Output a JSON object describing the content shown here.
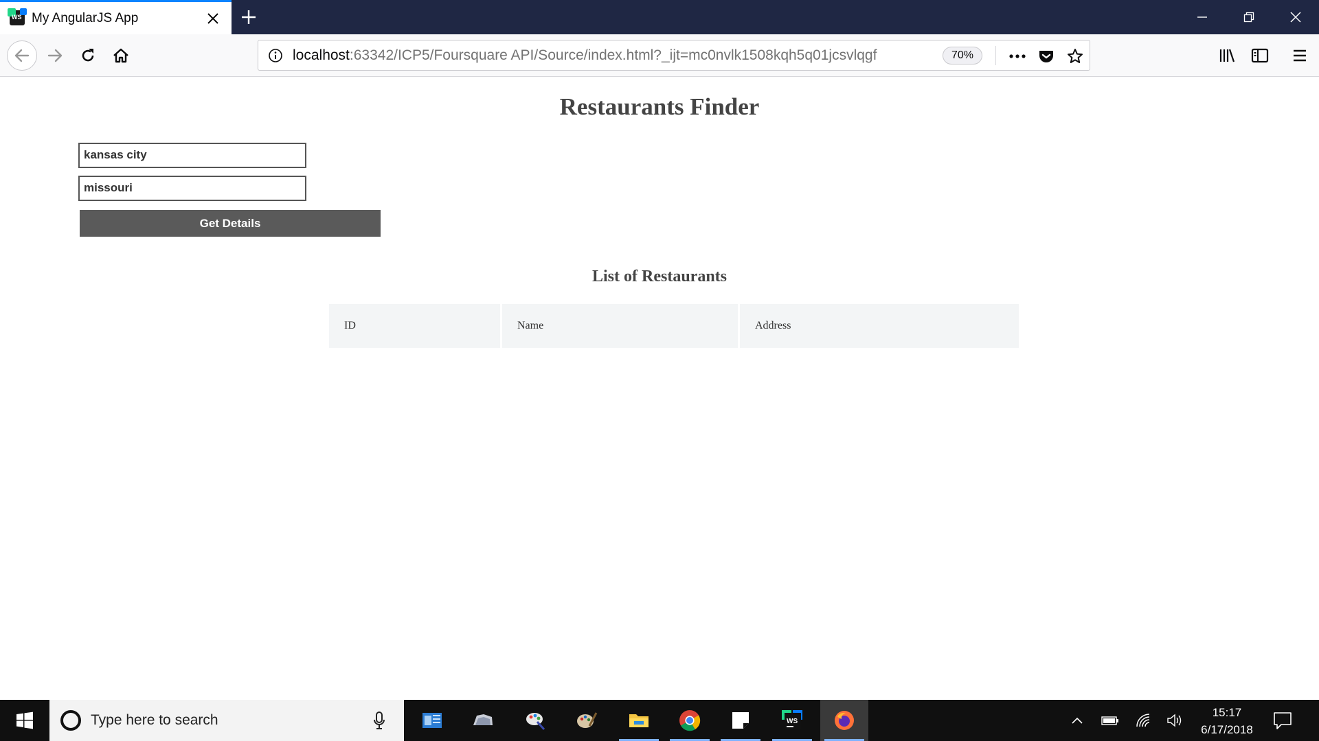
{
  "browser": {
    "tab_title": "My AngularJS App",
    "favicon_text": "WS",
    "url_host": "localhost",
    "url_rest": ":63342/ICP5/Foursquare API/Source/index.html?_ijt=mc0nvlk1508kqh5q01jcsvlqgf",
    "zoom": "70%"
  },
  "page": {
    "title": "Restaurants Finder",
    "city_input_value": "kansas city",
    "state_input_value": "missouri",
    "get_details_label": "Get Details",
    "list_title": "List of Restaurants",
    "table_headers": [
      "ID",
      "Name",
      "Address"
    ]
  },
  "taskbar": {
    "search_placeholder": "Type here to search",
    "time": "15:17",
    "date": "6/17/2018",
    "apps": [
      "outlook-icon",
      "onedrive-icon",
      "paint3d-icon",
      "paint-icon",
      "file-explorer-icon",
      "chrome-icon",
      "sticky-notes-icon",
      "webstorm-icon",
      "firefox-icon"
    ]
  }
}
